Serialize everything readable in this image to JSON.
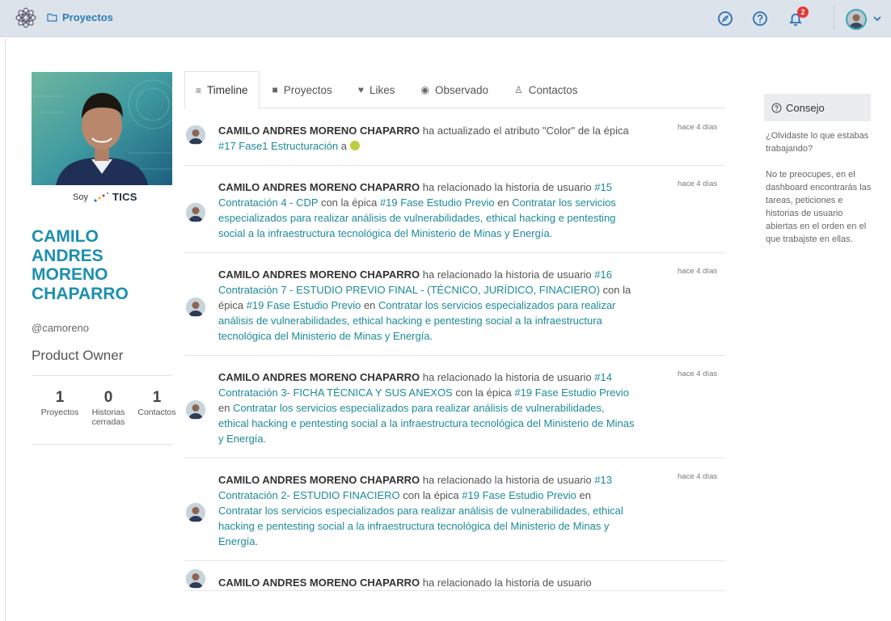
{
  "topbar": {
    "breadcrumb": "Proyectos",
    "notifications_count": "2"
  },
  "profile": {
    "soy_label": "Soy",
    "brand": "TICS",
    "name_lines": [
      "CAMILO",
      "ANDRES",
      "MORENO",
      "CHAPARRO"
    ],
    "username": "@camoreno",
    "role": "Product Owner",
    "stats": [
      {
        "value": "1",
        "label": "Proyectos"
      },
      {
        "value": "0",
        "label": "Historias cerradas"
      },
      {
        "value": "1",
        "label": "Contactos"
      }
    ]
  },
  "tabs": [
    {
      "label": "Timeline",
      "icon": "list-icon",
      "glyph": "≡"
    },
    {
      "label": "Proyectos",
      "icon": "projects-icon",
      "glyph": "■"
    },
    {
      "label": "Likes",
      "icon": "heart-icon",
      "glyph": "♥"
    },
    {
      "label": "Observado",
      "icon": "eye-icon",
      "glyph": "◉"
    },
    {
      "label": "Contactos",
      "icon": "contacts-icon",
      "glyph": "♙"
    }
  ],
  "feed": [
    {
      "author": "CAMILO ANDRES MORENO CHAPARRO",
      "time": "hace 4 días",
      "parts": [
        {
          "t": " ha actualizado el atributo \"Color\" de la épica "
        },
        {
          "link": "#17 Fase1 Estructuración"
        },
        {
          "t": " a "
        }
      ],
      "color_dot": "#b9cf3e"
    },
    {
      "author": "CAMILO ANDRES MORENO CHAPARRO",
      "time": "hace 4 días",
      "parts": [
        {
          "t": " ha relacionado la historia de usuario "
        },
        {
          "link": "#15 Contratación 4 - CDP"
        },
        {
          "t": " con la épica "
        },
        {
          "link": "#19 Fase Estudio Previo"
        },
        {
          "t": " en "
        },
        {
          "link": "Contratar los servicios especializados para realizar análisis de vulnerabilidades, ethical hacking e pentesting social a la infraestructura tecnológica del Ministerio de Minas y Energía."
        }
      ]
    },
    {
      "author": "CAMILO ANDRES MORENO CHAPARRO",
      "time": "hace 4 días",
      "parts": [
        {
          "t": " ha relacionado la historia de usuario "
        },
        {
          "link": "#16 Contratación 7 - ESTUDIO PREVIO FINAL - (TÉCNICO, JURÍDICO, FINACIERO)"
        },
        {
          "t": " con la épica "
        },
        {
          "link": "#19 Fase Estudio Previo"
        },
        {
          "t": " en "
        },
        {
          "link": "Contratar los servicios especializados para realizar análisis de vulnerabilidades, ethical hacking e pentesting social a la infraestructura tecnológica del Ministerio de Minas y Energía."
        }
      ]
    },
    {
      "author": "CAMILO ANDRES MORENO CHAPARRO",
      "time": "hace 4 días",
      "parts": [
        {
          "t": " ha relacionado la historia de usuario "
        },
        {
          "link": "#14 Contratación 3- FICHA TÉCNICA Y SUS ANEXOS"
        },
        {
          "t": " con la épica "
        },
        {
          "link": "#19 Fase Estudio Previo"
        },
        {
          "t": " en "
        },
        {
          "link": "Contratar los servicios especializados para realizar análisis de vulnerabilidades, ethical hacking e pentesting social a la infraestructura tecnológica del Ministerio de Minas y Energía."
        }
      ]
    },
    {
      "author": "CAMILO ANDRES MORENO CHAPARRO",
      "time": "hace 4 días",
      "parts": [
        {
          "t": " ha relacionado la historia de usuario "
        },
        {
          "link": "#13 Contratación 2- ESTUDIO FINACIERO"
        },
        {
          "t": " con la épica "
        },
        {
          "link": "#19 Fase Estudio Previo"
        },
        {
          "t": " en "
        },
        {
          "link": "Contratar los servicios especializados para realizar análisis de vulnerabilidades, ethical hacking e pentesting social a la infraestructura tecnológica del Ministerio de Minas y Energía."
        }
      ]
    },
    {
      "author": "CAMILO ANDRES MORENO CHAPARRO",
      "time": "",
      "parts": [
        {
          "t": " ha relacionado la historia de usuario"
        }
      ]
    }
  ],
  "tip": {
    "title": "Consejo",
    "paragraphs": [
      "¿Olvidaste lo que estabas trabajando?",
      "No te preocupes, en el dashboard encontrarás las tareas, peticiones e historias de usuario abiertas en el orden en el que trabajste en ellas."
    ]
  },
  "colors": {
    "accent": "#1d8fb0",
    "link": "#1d8a99",
    "topbar_bg": "#dde3ea",
    "badge": "#e53935"
  }
}
